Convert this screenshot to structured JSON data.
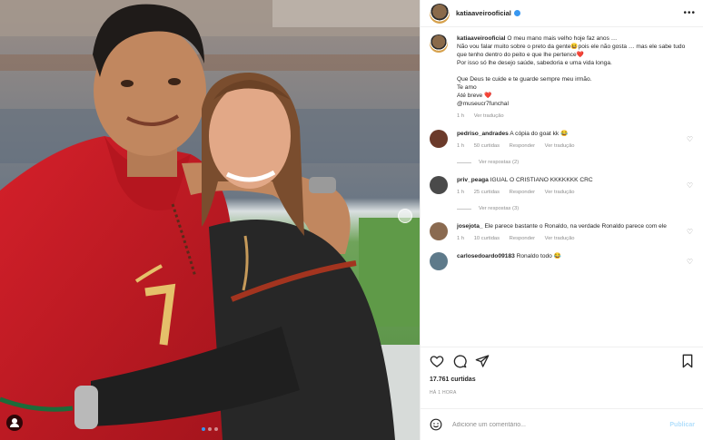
{
  "post": {
    "username": "katiaaveirooficial",
    "caption_lines": [
      "O meu mano mais velho hoje faz anos …",
      "Não vou falar muito sobre o preto da gente😆pois ele não gosta … mas ele sabe tudo que tenho dentro do peito e que lhe pertence❤️",
      "Por isso só lhe desejo saúde, sabedoria e uma vida longa.",
      "Que Deus te cuide e te guarde sempre meu irmão.",
      "Te amo",
      "Até breve ❤️",
      "@museucr7funchal"
    ],
    "caption_time": "1 h",
    "caption_translate": "Ver tradução"
  },
  "comments": [
    {
      "user": "pedriso_andrades",
      "text": "A cópia do goat kk 😂",
      "time": "1 h",
      "likes": "50 curtidas",
      "reply": "Responder",
      "translate": "Ver tradução",
      "replies": "Ver respostas (2)"
    },
    {
      "user": "priv_peaga",
      "text": "IGUAL O CRISTIANO KKKKKKK CRC",
      "time": "1 h",
      "likes": "25 curtidas",
      "reply": "Responder",
      "translate": "Ver tradução",
      "replies": "Ver respostas (3)"
    },
    {
      "user": "josejota_",
      "text": "Ele parece bastante o Ronaldo, na verdade Ronaldo parece com ele",
      "time": "1 h",
      "likes": "10 curtidas",
      "reply": "Responder",
      "translate": "Ver tradução",
      "replies": ""
    },
    {
      "user": "carlosedoardo09183",
      "text": "Ronaldo todo 😂",
      "time": "",
      "likes": "",
      "reply": "",
      "translate": "",
      "replies": ""
    }
  ],
  "likes_count": "17.761 curtidas",
  "posted_ago": "HÁ 1 HORA",
  "add_comment": {
    "placeholder": "Adicione um comentário...",
    "publish_label": "Publicar"
  },
  "icons": {
    "more": "more-options-icon",
    "like": "heart-icon",
    "comment": "comment-icon",
    "share": "share-icon",
    "save": "bookmark-icon",
    "emoji": "emoji-icon",
    "tag": "user-tag-icon"
  },
  "colors": {
    "link_blue": "#3897f0",
    "heart_red": "#ed4956",
    "muted_text": "#8e8e8e"
  }
}
